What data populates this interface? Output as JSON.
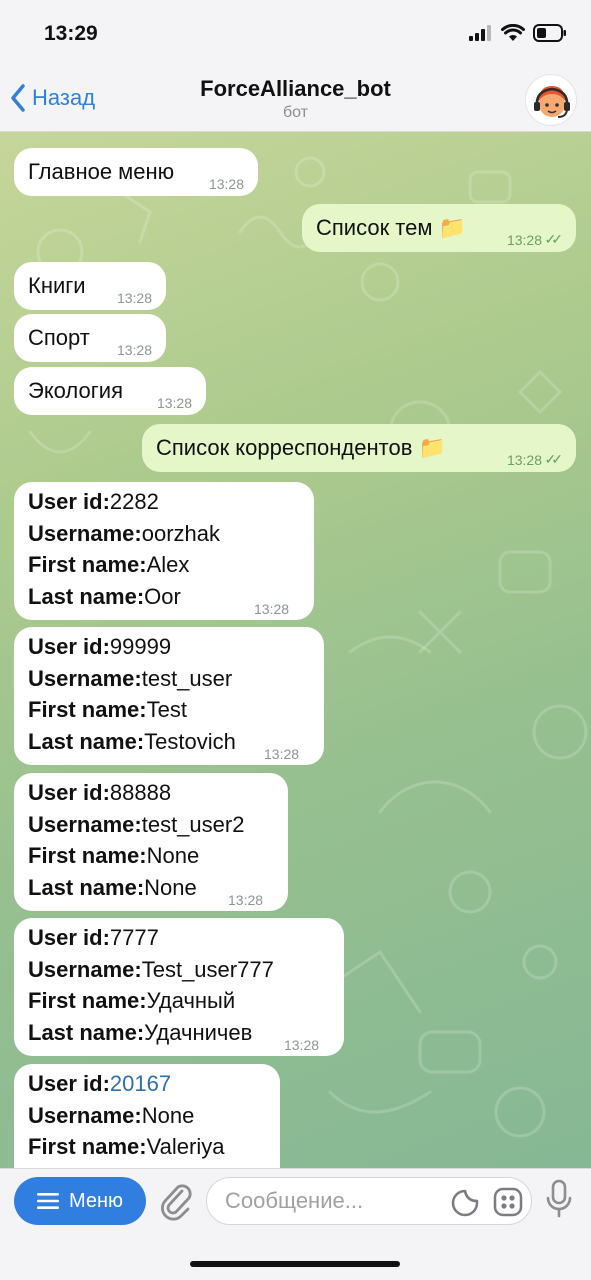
{
  "status": {
    "time": "13:29"
  },
  "nav": {
    "back_label": "Назад",
    "title": "ForceAlliance_bot",
    "subtitle": "бот"
  },
  "messages": [
    {
      "text": "Главное меню",
      "time": "13:28",
      "dir": "in"
    },
    {
      "text": "Список тем 📁",
      "time": "13:28",
      "dir": "out",
      "status": "read"
    },
    {
      "text": "Книги",
      "time": "13:28",
      "dir": "in"
    },
    {
      "text": "Спорт",
      "time": "13:28",
      "dir": "in"
    },
    {
      "text": "Экология",
      "time": "13:28",
      "dir": "in"
    },
    {
      "text": "Список корреспондентов 📁",
      "time": "13:28",
      "dir": "out",
      "status": "read"
    }
  ],
  "field_labels": {
    "user_id": "User id:",
    "username": "Username:",
    "first_name": "First name:",
    "last_name": "Last name:"
  },
  "users": [
    {
      "user_id": "2282",
      "username": "oorzhak",
      "first_name": "Alex",
      "last_name": "Oor",
      "time": "13:28"
    },
    {
      "user_id": "99999",
      "username": "test_user",
      "first_name": "Test",
      "last_name": "Testovich",
      "time": "13:28"
    },
    {
      "user_id": "88888",
      "username": "test_user2",
      "first_name": "None",
      "last_name": "None",
      "time": "13:28"
    },
    {
      "user_id": "7777",
      "username": "Test_user777",
      "first_name": "Удачный",
      "last_name": "Удачничев",
      "time": "13:28"
    },
    {
      "user_id": "20167",
      "username": "None",
      "first_name": "Valeriya",
      "last_name": ""
    }
  ],
  "input": {
    "menu_label": "Меню",
    "placeholder": "Сообщение..."
  },
  "icons": {
    "back": "chevron-left-icon",
    "menu": "hamburger-icon",
    "attach": "paperclip-icon",
    "sticker": "sticker-icon",
    "emoji": "emoji-grid-icon",
    "mic": "microphone-icon",
    "read": "double-check-icon"
  },
  "colors": {
    "accent": "#2f7ee0",
    "outgoing_bubble": "#e5f7c8",
    "incoming_bubble": "#ffffff",
    "link": "#2f6fb6"
  }
}
